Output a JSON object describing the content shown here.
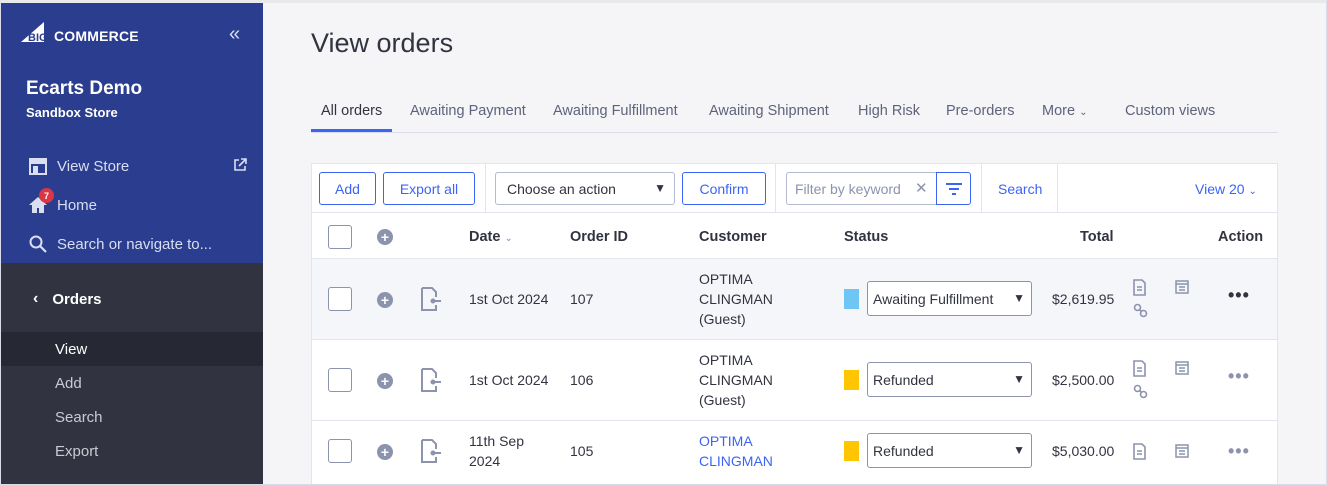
{
  "brand": {
    "logo_big": "BIG",
    "logo_commerce": "COMMERCE"
  },
  "store": {
    "name": "Ecarts Demo",
    "sub": "Sandbox Store"
  },
  "nav": {
    "view_store": "View Store",
    "home": "Home",
    "home_badge": "7",
    "search": "Search or navigate to..."
  },
  "section": {
    "title": "Orders",
    "items": [
      "View",
      "Add",
      "Search",
      "Export"
    ]
  },
  "page": {
    "title": "View orders"
  },
  "tabs": [
    "All orders",
    "Awaiting Payment",
    "Awaiting Fulfillment",
    "Awaiting Shipment",
    "High Risk",
    "Pre-orders",
    "More",
    "Custom views"
  ],
  "toolbar": {
    "add": "Add",
    "export_all": "Export all",
    "action_select": "Choose an action",
    "confirm": "Confirm",
    "filter_placeholder": "Filter by keyword",
    "search": "Search",
    "view": "View 20"
  },
  "columns": {
    "date": "Date",
    "order_id": "Order ID",
    "customer": "Customer",
    "status": "Status",
    "total": "Total",
    "action": "Action"
  },
  "orders": [
    {
      "date_1": "1st Oct 2024",
      "date_2": "",
      "id": "107",
      "customer_1": "OPTIMA",
      "customer_2": "CLINGMAN",
      "customer_3": "(Guest)",
      "status": "Awaiting Fulfillment",
      "status_color": "#6fc6f5",
      "total": "$2,619.95"
    },
    {
      "date_1": "1st Oct 2024",
      "date_2": "",
      "id": "106",
      "customer_1": "OPTIMA",
      "customer_2": "CLINGMAN",
      "customer_3": "(Guest)",
      "status": "Refunded",
      "status_color": "#ffc500",
      "total": "$2,500.00"
    },
    {
      "date_1": "11th Sep",
      "date_2": "2024",
      "id": "105",
      "customer_1": "OPTIMA",
      "customer_2": "CLINGMAN",
      "customer_3": "",
      "status": "Refunded",
      "status_color": "#ffc500",
      "total": "$5,030.00"
    }
  ],
  "colors": {
    "sidebar_top": "#2a3d8f",
    "sidebar_bottom": "#313440",
    "accent": "#3c64f4"
  }
}
